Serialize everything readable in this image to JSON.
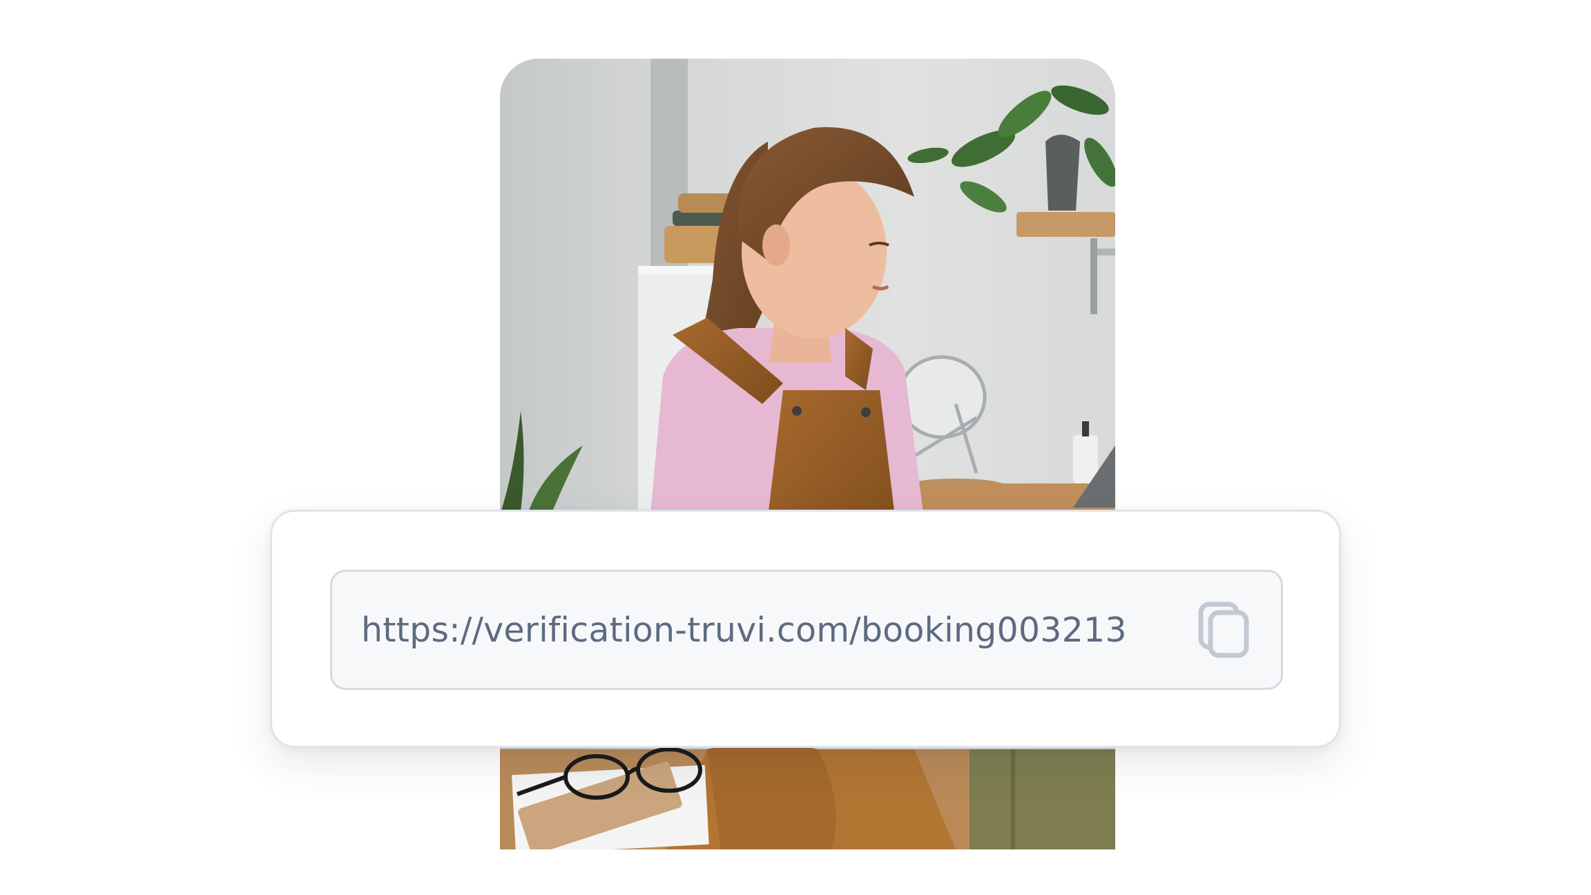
{
  "share_link": {
    "url": "https://verification-truvi.com/booking003213",
    "copy_icon": "copy-icon"
  },
  "photo": {
    "subject": "photo-woman-working-at-laptop"
  },
  "colors": {
    "card_border": "#dfe3ea",
    "field_background": "#f7f8fa",
    "field_border": "#d5dae2",
    "url_text": "#5e6a80",
    "icon": "#c3c9d3"
  }
}
